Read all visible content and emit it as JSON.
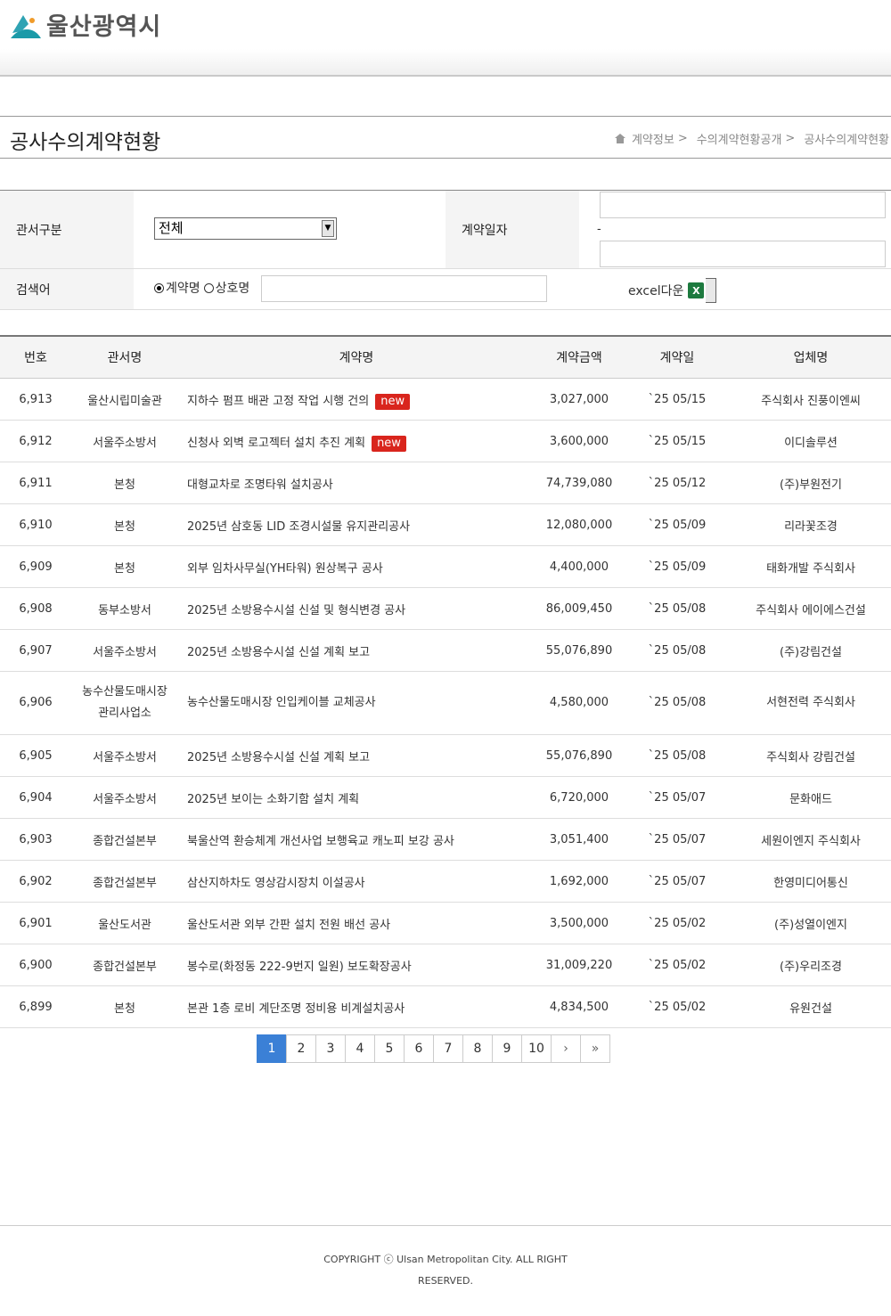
{
  "header": {
    "logo_text": "울산광역시"
  },
  "page": {
    "title": "공사수의계약현황",
    "breadcrumb": [
      "계약정보",
      "수의계약현황공개",
      "공사수의계약현황"
    ]
  },
  "search": {
    "office_label": "관서구분",
    "office_value": "전체",
    "date_label": "계약일자",
    "date_separator": "-",
    "keyword_label": "검색어",
    "radio_contract": "계약명",
    "radio_company": "상호명",
    "excel_label": "excel다운"
  },
  "table": {
    "headers": [
      "번호",
      "관서명",
      "계약명",
      "계약금액",
      "계약일",
      "업체명"
    ],
    "new_badge": "new",
    "rows": [
      {
        "no": "6,913",
        "office": "울산시립미술관",
        "name": "지하수 펌프 배관 고정 작업 시행 건의",
        "amount": "3,027,000",
        "date": "`25 05/15",
        "company": "주식회사 진풍이엔씨",
        "new": true
      },
      {
        "no": "6,912",
        "office": "서울주소방서",
        "name": "신청사 외벽 로고젝터 설치 추진 계획",
        "amount": "3,600,000",
        "date": "`25 05/15",
        "company": "이디솔루션",
        "new": true
      },
      {
        "no": "6,911",
        "office": "본청",
        "name": "대형교차로 조명타워 설치공사",
        "amount": "74,739,080",
        "date": "`25 05/12",
        "company": "(주)부원전기"
      },
      {
        "no": "6,910",
        "office": "본청",
        "name": "2025년 삼호동 LID 조경시설물 유지관리공사",
        "amount": "12,080,000",
        "date": "`25 05/09",
        "company": "리라꽃조경"
      },
      {
        "no": "6,909",
        "office": "본청",
        "name": "외부 임차사무실(YH타워) 원상복구 공사",
        "amount": "4,400,000",
        "date": "`25 05/09",
        "company": "태화개발 주식회사"
      },
      {
        "no": "6,908",
        "office": "동부소방서",
        "name": "2025년 소방용수시설 신설 및 형식변경 공사",
        "amount": "86,009,450",
        "date": "`25 05/08",
        "company": "주식회사 에이에스건설"
      },
      {
        "no": "6,907",
        "office": "서울주소방서",
        "name": "2025년 소방용수시설 신설 계획 보고",
        "amount": "55,076,890",
        "date": "`25 05/08",
        "company": "(주)강림건설"
      },
      {
        "no": "6,906",
        "office": "농수산물도매시장 관리사업소",
        "office_l1": "농수산물도매시장",
        "office_l2": "관리사업소",
        "name": "농수산물도매시장 인입케이블 교체공사",
        "amount": "4,580,000",
        "date": "`25 05/08",
        "company": "서현전력 주식회사",
        "tall": true
      },
      {
        "no": "6,905",
        "office": "서울주소방서",
        "name": "2025년 소방용수시설 신설 계획 보고",
        "amount": "55,076,890",
        "date": "`25 05/08",
        "company": "주식회사 강림건설"
      },
      {
        "no": "6,904",
        "office": "서울주소방서",
        "name": "2025년 보이는 소화기함 설치 계획",
        "amount": "6,720,000",
        "date": "`25 05/07",
        "company": "문화애드"
      },
      {
        "no": "6,903",
        "office": "종합건설본부",
        "name": "북울산역 환승체계 개선사업 보행육교 캐노피 보강 공사",
        "amount": "3,051,400",
        "date": "`25 05/07",
        "company": "세원이엔지 주식회사"
      },
      {
        "no": "6,902",
        "office": "종합건설본부",
        "name": "삼산지하차도 영상감시장치 이설공사",
        "amount": "1,692,000",
        "date": "`25 05/07",
        "company": "한영미디어통신"
      },
      {
        "no": "6,901",
        "office": "울산도서관",
        "name": "울산도서관 외부 간판 설치 전원 배선 공사",
        "amount": "3,500,000",
        "date": "`25 05/02",
        "company": "(주)성열이엔지"
      },
      {
        "no": "6,900",
        "office": "종합건설본부",
        "name": "봉수로(화정동 222-9번지 일원) 보도확장공사",
        "amount": "31,009,220",
        "date": "`25 05/02",
        "company": "(주)우리조경"
      },
      {
        "no": "6,899",
        "office": "본청",
        "name": "본관 1층 로비 계단조명 정비용 비계설치공사",
        "amount": "4,834,500",
        "date": "`25 05/02",
        "company": "유원건설"
      }
    ]
  },
  "pagination": {
    "pages": [
      "1",
      "2",
      "3",
      "4",
      "5",
      "6",
      "7",
      "8",
      "9",
      "10"
    ],
    "current": "1",
    "next": "›",
    "last": "»"
  },
  "footer": {
    "copyright_l1": "COPYRIGHT ⓒ Ulsan Metropolitan City. ALL RIGHT",
    "copyright_l2": "RESERVED."
  },
  "colors": {
    "accent": "#3b80d6",
    "new_badge": "#d9251d",
    "logo": "#1b9aa8"
  }
}
